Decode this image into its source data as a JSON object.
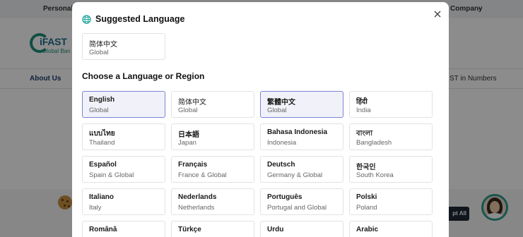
{
  "background": {
    "topbar": {
      "personal": "Personal",
      "company": "Company"
    },
    "logo": {
      "word": "iFAST",
      "sub": "Global Ban"
    },
    "nav": {
      "about": "About Us",
      "numbers": "ST in Numbers"
    },
    "cookie": {
      "accept": "pt All"
    }
  },
  "modal": {
    "title": "Suggested Language",
    "suggested": {
      "name": "简体中文",
      "region": "Global"
    },
    "section_heading": "Choose a Language or Region",
    "languages": [
      {
        "name": "English",
        "region": "Global"
      },
      {
        "name": "简体中文",
        "region": "Global"
      },
      {
        "name": "繁體中文",
        "region": "Global"
      },
      {
        "name": "हिंदी",
        "region": "India"
      },
      {
        "name": "แบบไทย",
        "region": "Thailand"
      },
      {
        "name": "日本語",
        "region": "Japan"
      },
      {
        "name": "Bahasa Indonesia",
        "region": "Indonesia"
      },
      {
        "name": "বাংলা",
        "region": "Bangladesh"
      },
      {
        "name": "Español",
        "region": "Spain & Global"
      },
      {
        "name": "Français",
        "region": "France & Global"
      },
      {
        "name": "Deutsch",
        "region": "Germany & Global"
      },
      {
        "name": "한국인",
        "region": "South Korea"
      },
      {
        "name": "Italiano",
        "region": "Italy"
      },
      {
        "name": "Nederlands",
        "region": "Netherlands"
      },
      {
        "name": "Português",
        "region": "Portugal and Global"
      },
      {
        "name": "Polski",
        "region": "Poland"
      },
      {
        "name": "Română",
        "region": ""
      },
      {
        "name": "Türkçe",
        "region": ""
      },
      {
        "name": "Urdu",
        "region": ""
      },
      {
        "name": "Arabic",
        "region": ""
      }
    ]
  },
  "colors": {
    "accent": "#7b83d9",
    "selected_bg": "#f1f2f9",
    "globe": "#1aa39a"
  }
}
